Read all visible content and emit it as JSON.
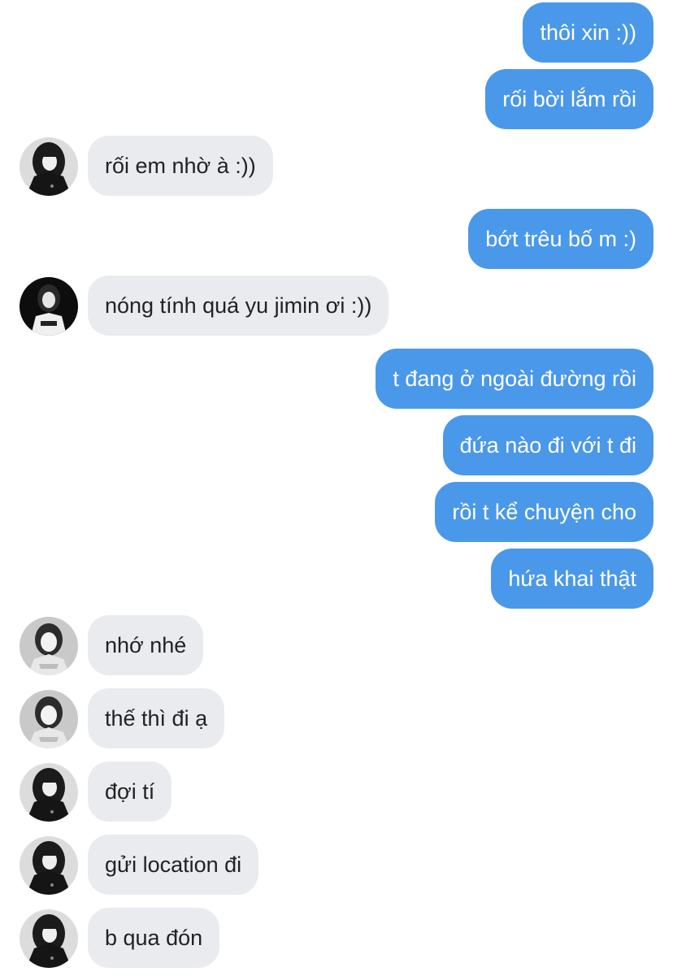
{
  "conversation": {
    "messages": [
      {
        "side": "out",
        "text": "thôi xin :))"
      },
      {
        "side": "out",
        "text": "rối bời lắm rồi"
      },
      {
        "side": "in",
        "text": "rối em nhờ à :))",
        "avatar": "avatar-dark-portrait"
      },
      {
        "side": "out",
        "text": "bớt trêu bố m :)"
      },
      {
        "side": "in",
        "text": "nóng tính quá yu jimin ơi :))",
        "avatar": "avatar-black-background"
      },
      {
        "side": "out",
        "text": "t đang ở ngoài đường rồi"
      },
      {
        "side": "out",
        "text": "đứa nào đi với t đi"
      },
      {
        "side": "out",
        "text": "rồi t kể chuyện cho"
      },
      {
        "side": "out",
        "text": "hứa khai thật"
      },
      {
        "side": "in",
        "text": "nhớ nhé",
        "avatar": "avatar-light-portrait"
      },
      {
        "side": "in",
        "text": "thế thì đi ạ",
        "avatar": "avatar-light-portrait"
      },
      {
        "side": "in",
        "text": "đợi tí",
        "avatar": "avatar-dark-portrait"
      },
      {
        "side": "in",
        "text": "gửi location đi",
        "avatar": "avatar-dark-portrait"
      },
      {
        "side": "in",
        "text": "b qua đón",
        "avatar": "avatar-dark-portrait"
      }
    ]
  },
  "colors": {
    "outgoing_bubble": "#4a98e9",
    "incoming_bubble": "#e9ebef",
    "outgoing_text": "#ffffff",
    "incoming_text": "#222222"
  }
}
